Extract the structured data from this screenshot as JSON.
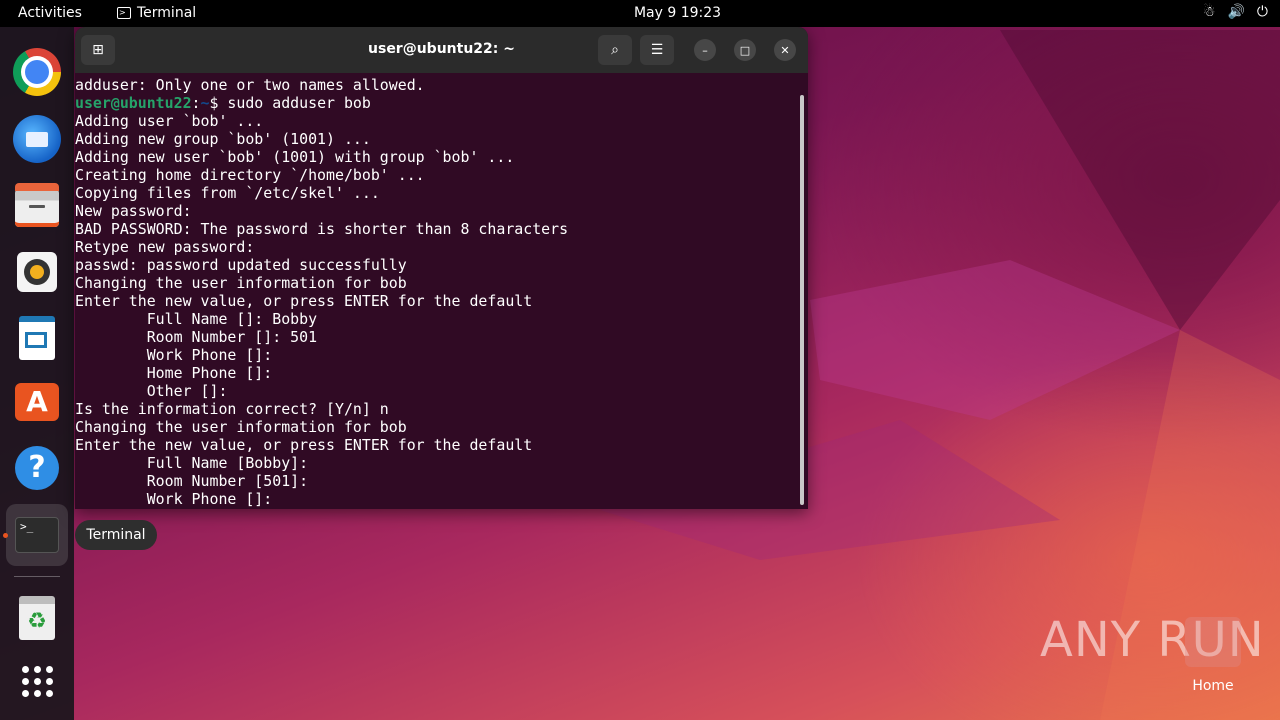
{
  "topbar": {
    "activities": "Activities",
    "app_name": "Terminal",
    "app_icon": "terminal-icon",
    "clock": "May 9  19:23",
    "tray_icons": [
      "network-icon",
      "volume-icon",
      "power-icon"
    ]
  },
  "dock": {
    "items": [
      {
        "name": "chrome",
        "icon": "chrome-icon"
      },
      {
        "name": "thunderbird",
        "icon": "thunderbird-icon"
      },
      {
        "name": "files",
        "icon": "files-icon"
      },
      {
        "name": "rhythmbox",
        "icon": "rhythmbox-icon"
      },
      {
        "name": "libreoffice-writer",
        "icon": "writer-icon"
      },
      {
        "name": "ubuntu-software",
        "icon": "appstore-icon"
      },
      {
        "name": "help",
        "icon": "help-icon"
      },
      {
        "name": "terminal",
        "icon": "terminal-icon",
        "running": true
      },
      {
        "name": "trash",
        "icon": "trash-icon"
      },
      {
        "name": "show-applications",
        "icon": "apps-grid-icon"
      }
    ],
    "terminal_glyph": ">_",
    "help_glyph": "?",
    "appstore_glyph": "A",
    "trash_glyph": "♻"
  },
  "terminal": {
    "title": "user@ubuntu22: ~",
    "prompt_user": "user@ubuntu22",
    "prompt_sep": ":",
    "prompt_path": "~",
    "prompt_end": "$ ",
    "lines": [
      "adduser: Only one or two names allowed.",
      "sudo adduser bob",
      "Adding user `bob' ...",
      "Adding new group `bob' (1001) ...",
      "Adding new user `bob' (1001) with group `bob' ...",
      "Creating home directory `/home/bob' ...",
      "Copying files from `/etc/skel' ...",
      "New password: ",
      "BAD PASSWORD: The password is shorter than 8 characters",
      "Retype new password: ",
      "passwd: password updated successfully",
      "Changing the user information for bob",
      "Enter the new value, or press ENTER for the default",
      "\tFull Name []: Bobby",
      "\tRoom Number []: 501",
      "\tWork Phone []: ",
      "\tHome Phone []: ",
      "\tOther []: ",
      "Is the information correct? [Y/n] n",
      "Changing the user information for bob",
      "Enter the new value, or press ENTER for the default",
      "\tFull Name [Bobby]: ",
      "\tRoom Number [501]: ",
      "\tWork Phone []: "
    ]
  },
  "tooltip": "Terminal",
  "desktop": {
    "home_label": "Home",
    "watermark": "ANY RUN"
  },
  "colors": {
    "terminal_bg": "#300a24",
    "prompt_user": "#26a269",
    "prompt_path": "#12488b",
    "accent": "#e95420"
  }
}
